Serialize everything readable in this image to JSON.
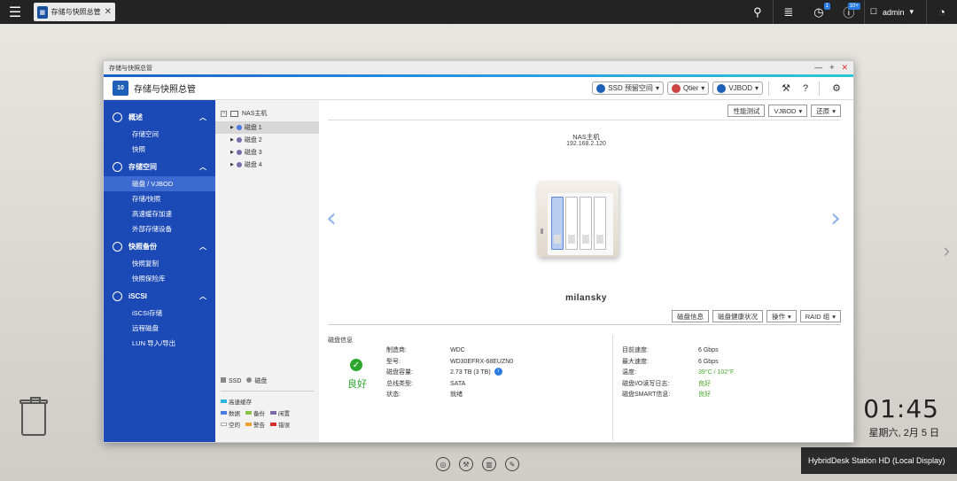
{
  "taskbar": {
    "tab_label": "存储与快照总管",
    "user": "admin",
    "badges": {
      "tasks": "1",
      "notifications": "10+"
    }
  },
  "window": {
    "title": "存储与快照总管",
    "app_name": "存储与快照总管",
    "header_buttons": [
      "SSD 预留空间",
      "Qtier",
      "VJBOD"
    ]
  },
  "sidebar": {
    "sections": [
      {
        "label": "概述",
        "icon": "dashboard-icon",
        "items": [
          "存储空间",
          "快照"
        ]
      },
      {
        "label": "存储空间",
        "icon": "database-icon",
        "items": [
          "磁盘 / VJBOD",
          "存储/快照",
          "高速缓存加速",
          "外部存储设备"
        ]
      },
      {
        "label": "快照备份",
        "icon": "snapshot-icon",
        "items": [
          "快照复制",
          "快照保险库"
        ]
      },
      {
        "label": "iSCSI",
        "icon": "iscsi-icon",
        "items": [
          "iSCSI存储",
          "远程磁盘",
          "LUN 导入/导出"
        ]
      }
    ],
    "active_item": "磁盘 / VJBOD"
  },
  "tree": {
    "root": "NAS主机",
    "disks": [
      "磁盘 1",
      "磁盘 2",
      "磁盘 3",
      "磁盘 4"
    ],
    "legend_type": [
      "SSD",
      "磁盘"
    ],
    "legend_status": [
      [
        {
          "label": "高速缓存",
          "color": "#2ab5e0"
        }
      ],
      [
        {
          "label": "数据",
          "color": "#4a7be0"
        },
        {
          "label": "备份",
          "color": "#8ac34a"
        },
        {
          "label": "闲置",
          "color": "#7a6aa8"
        }
      ],
      [
        {
          "label": "空的",
          "color": "#ffffff"
        },
        {
          "label": "警告",
          "color": "#f0a030"
        },
        {
          "label": "错误",
          "color": "#d83030"
        }
      ]
    ]
  },
  "main": {
    "toolbar": [
      "性能测试",
      "VJBOD",
      "还原"
    ],
    "nas_title": "NAS主机",
    "nas_ip": "192.168.2.120",
    "nas_name": "milansky",
    "disk_toolbar": [
      "磁盘信息",
      "磁盘健康状况",
      "操作",
      "RAID 组"
    ],
    "info_title": "磁盘信息",
    "status": "良好",
    "left_info": [
      {
        "k": "制造商:",
        "v": "WDC"
      },
      {
        "k": "型号:",
        "v": "WD30EFRX-68EUZN0"
      },
      {
        "k": "磁盘容量:",
        "v": "2.73 TB (3 TB)"
      },
      {
        "k": "总线类型:",
        "v": "SATA"
      },
      {
        "k": "状态:",
        "v": "就绪"
      }
    ],
    "right_info": [
      {
        "k": "目前速度:",
        "v": "6 Gbps"
      },
      {
        "k": "最大速度:",
        "v": "6 Gbps"
      },
      {
        "k": "温度:",
        "v": "39°C / 102°F"
      },
      {
        "k": "磁盘I/O读写日志:",
        "v": "良好"
      },
      {
        "k": "磁盘SMART信息:",
        "v": "良好"
      }
    ]
  },
  "desktop": {
    "time": "01:45",
    "date": "星期六, 2月 5 日",
    "brand_text": "HybridDesk Station HD (Local Display)"
  }
}
